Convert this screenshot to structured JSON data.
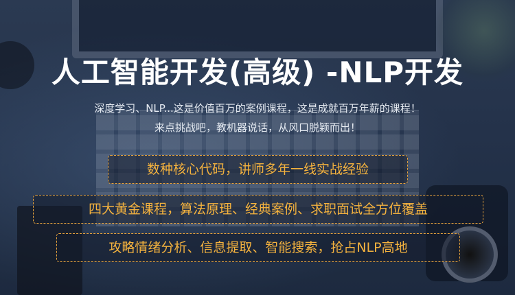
{
  "headline": "人工智能开发(高级) -NLP开发",
  "subtitle_lines": [
    "深度学习、NLP...这是价值百万的案例课程，这是成就百万年薪的课程！",
    "来点挑战吧，教机器说话，从风口脱颖而出！"
  ],
  "features": [
    "数种核心代码，讲师多年一线实战经验",
    "四大黄金课程，算法原理、经典案例、求职面试全方位覆盖",
    "攻略情绪分析、信息提取、智能搜索，抢占NLP高地"
  ],
  "colors": {
    "background": "#24324a",
    "headline": "#ffffff",
    "accent": "#f4b23e",
    "border": "#e8a33c"
  }
}
